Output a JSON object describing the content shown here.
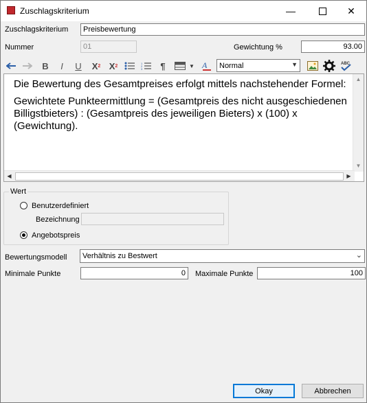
{
  "window": {
    "title": "Zuschlagskriterium",
    "minimize": "—",
    "maximize": "☐",
    "close": "✕"
  },
  "form": {
    "zuschlagskriterium_label": "Zuschlagskriterium",
    "zuschlagskriterium_value": "Preisbewertung",
    "nummer_label": "Nummer",
    "nummer_value": "01",
    "gewichtung_label": "Gewichtung %",
    "gewichtung_value": "93.00"
  },
  "toolbar": {
    "style_value": "Normal",
    "icons": [
      "undo-icon",
      "redo-icon",
      "bold-icon",
      "italic-icon",
      "underline-icon",
      "superscript-icon",
      "subscript-icon",
      "bullet-list-icon",
      "numbered-list-icon",
      "paragraph-icon",
      "table-icon",
      "dropdown-arrow-icon",
      "font-color-icon",
      "style-select",
      "image-icon",
      "gear-icon",
      "spellcheck-icon"
    ]
  },
  "editor": {
    "paragraph1": " Die Bewertung des Gesamtpreises erfolgt mittels nachstehender Formel:",
    "paragraph2": "Gewichtete Punkteermittlung = (Gesamtpreis des nicht ausgeschiedenen Billigstbieters) : (Gesamtpreis des jeweiligen Bieters) x (100) x (Gewichtung)."
  },
  "wert": {
    "group_label": "Wert",
    "option1": "Benutzerdefiniert",
    "bezeichnung_label": "Bezeichnung",
    "bezeichnung_value": "",
    "option2": "Angebotspreis",
    "selected": "Angebotspreis"
  },
  "bewertung": {
    "modell_label": "Bewertungsmodell",
    "modell_value": "Verhältnis zu Bestwert",
    "min_label": "Minimale Punkte",
    "min_value": "0",
    "max_label": "Maximale Punkte",
    "max_value": "100"
  },
  "buttons": {
    "ok": "Okay",
    "cancel": "Abbrechen"
  }
}
